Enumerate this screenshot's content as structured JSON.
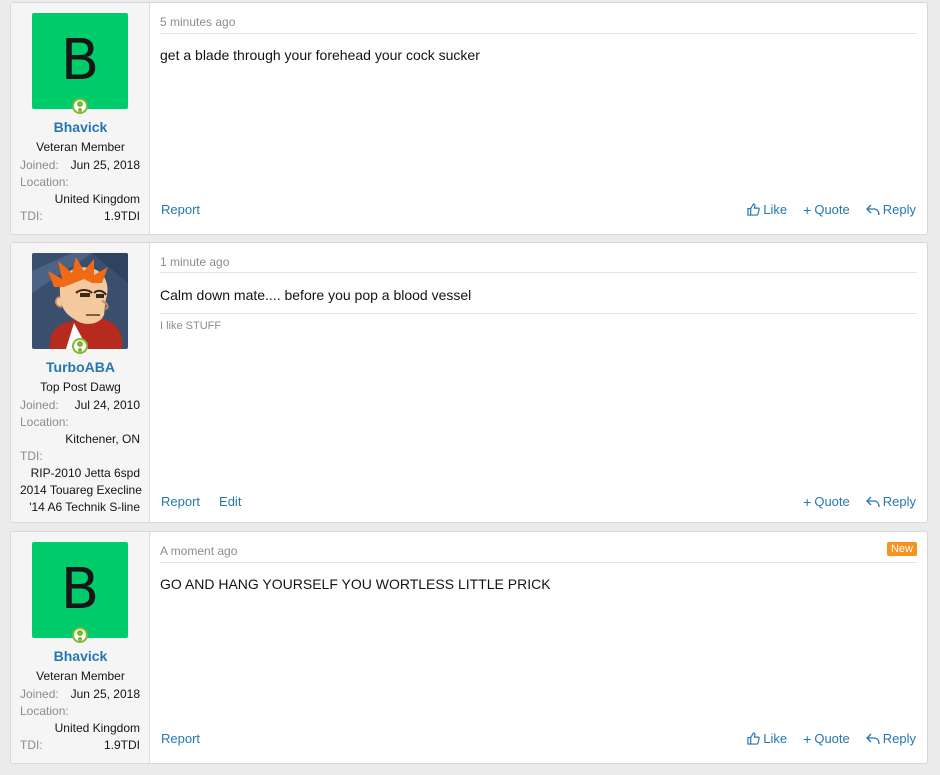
{
  "posts": [
    {
      "user": {
        "avatar_letter": "B",
        "avatar_color": "#00cc6b",
        "username": "Bhavick",
        "title": "Veteran Member",
        "joined_label": "Joined:",
        "joined": "Jun 25, 2018",
        "location_label": "Location:",
        "location": "United Kingdom",
        "tdi_label": "TDI:",
        "tdi": "1.9TDI"
      },
      "date": "5 minutes ago",
      "message": "get a blade through your forehead your cock sucker",
      "actions": {
        "report": "Report",
        "like": "Like",
        "quote": "Quote",
        "reply": "Reply"
      }
    },
    {
      "user": {
        "avatar_icon": "cartoon-fry-avatar",
        "username": "TurboABA",
        "title": "Top Post Dawg",
        "joined_label": "Joined:",
        "joined": "Jul 24, 2010",
        "location_label": "Location:",
        "location": "Kitchener, ON",
        "tdi_label": "TDI:",
        "tdi_lines": [
          "RIP-2010 Jetta 6spd",
          "2014 Touareg Execline",
          "'14 A6 Technik S-line"
        ]
      },
      "date": "1 minute ago",
      "message": "Calm down mate.... before you pop a blood vessel",
      "signature": "I like STUFF",
      "actions": {
        "report": "Report",
        "edit": "Edit",
        "quote": "Quote",
        "reply": "Reply"
      }
    },
    {
      "user": {
        "avatar_letter": "B",
        "avatar_color": "#00cc6b",
        "username": "Bhavick",
        "title": "Veteran Member",
        "joined_label": "Joined:",
        "joined": "Jun 25, 2018",
        "location_label": "Location:",
        "location": "United Kingdom",
        "tdi_label": "TDI:",
        "tdi": "1.9TDI"
      },
      "date": "A moment ago",
      "badge": "New",
      "message": "GO AND HANG YOURSELF YOU WORTLESS LITTLE PRICK",
      "actions": {
        "report": "Report",
        "like": "Like",
        "quote": "Quote",
        "reply": "Reply"
      }
    }
  ],
  "colors": {
    "link": "#2577b1",
    "badge": "#f7921e",
    "online": "#7fb833",
    "muted": "#8c8c8c"
  }
}
